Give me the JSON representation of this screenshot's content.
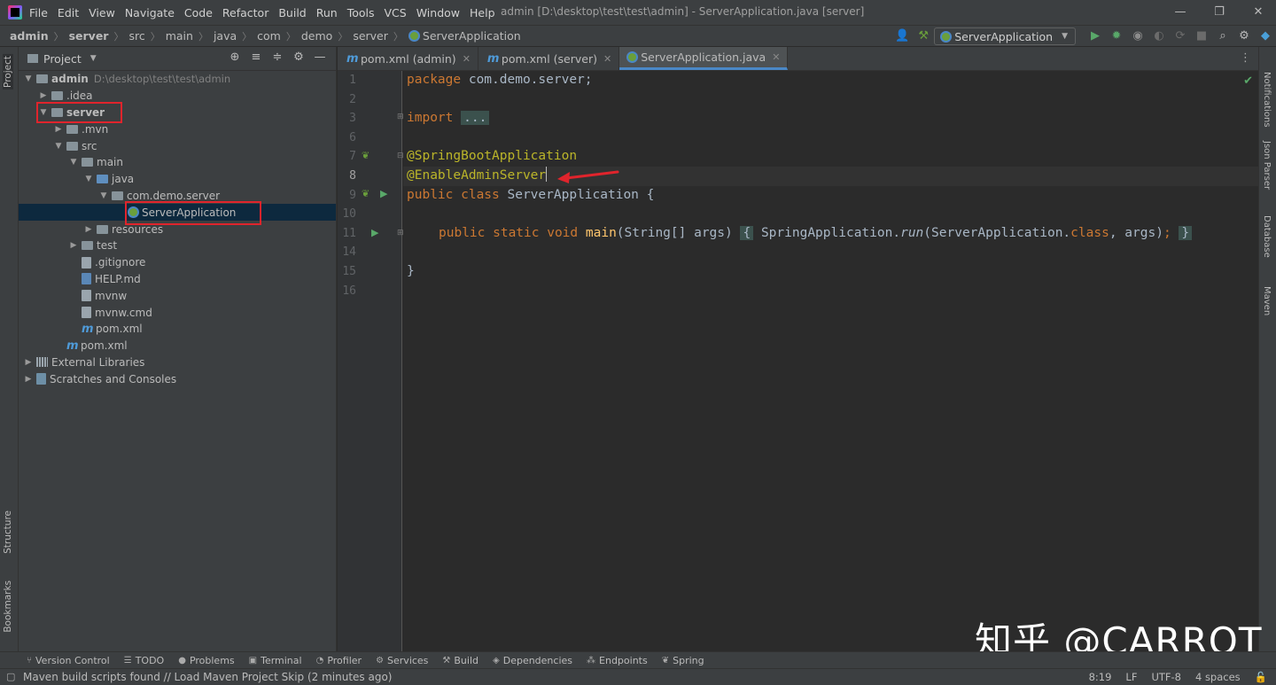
{
  "menu": [
    "File",
    "Edit",
    "View",
    "Navigate",
    "Code",
    "Refactor",
    "Build",
    "Run",
    "Tools",
    "VCS",
    "Window",
    "Help"
  ],
  "window_title": "admin [D:\\desktop\\test\\test\\admin] - ServerApplication.java [server]",
  "breadcrumbs": [
    "admin",
    "server",
    "src",
    "main",
    "java",
    "com",
    "demo",
    "server",
    "ServerApplication"
  ],
  "run_config": "ServerApplication",
  "project_panel": {
    "title": "Project"
  },
  "tree": {
    "root": "admin",
    "root_path": "D:\\desktop\\test\\test\\admin",
    "idea": ".idea",
    "server": "server",
    "mvn": ".mvn",
    "src": "src",
    "main": "main",
    "java": "java",
    "package": "com.demo.server",
    "server_app": "ServerApplication",
    "resources": "resources",
    "test": "test",
    "gitignore": ".gitignore",
    "help": "HELP.md",
    "mvnw": "mvnw",
    "mvnw_cmd": "mvnw.cmd",
    "pom_server": "pom.xml",
    "pom_admin": "pom.xml",
    "ext_libs": "External Libraries",
    "scratches": "Scratches and Consoles"
  },
  "tabs": [
    "pom.xml (admin)",
    "pom.xml (server)",
    "ServerApplication.java"
  ],
  "code": {
    "l1_kw": "package",
    "l1_rest": " com.demo.server;",
    "l3_kw": "import",
    "l3_fold": "...",
    "l5": "@SpringBootApplication",
    "l6": "@EnableAdminServer",
    "l7_kw": "public class",
    "l7_rest": " ServerApplication {",
    "l9_kw": "public static void",
    "l9_fn": "main",
    "l9_a": "(String[] args)",
    "l9_b": "{",
    "l9_c": " SpringApplication.",
    "l9_run": "run",
    "l9_d": "(ServerApplication.",
    "l9_class": "class",
    "l9_e": ", args)",
    "l9_semi": ";",
    "l9_f": "}",
    "l11": "}"
  },
  "line_numbers": [
    "1",
    "2",
    "3",
    "6",
    "7",
    "8",
    "9",
    "10",
    "11",
    "14",
    "15",
    "16"
  ],
  "right_tools": [
    "Notifications",
    "Json Parser",
    "Database",
    "Maven"
  ],
  "left_tools": [
    "Project",
    "Structure",
    "Bookmarks"
  ],
  "bottom_tools": [
    "Version Control",
    "TODO",
    "Problems",
    "Terminal",
    "Profiler",
    "Services",
    "Build",
    "Dependencies",
    "Endpoints",
    "Spring"
  ],
  "status_message": "Maven build scripts found // Load Maven Project   Skip (2 minutes ago)",
  "status_right": [
    "8:19",
    "LF",
    "UTF-8",
    "4 spaces"
  ],
  "watermark": "知乎 @CARROT"
}
